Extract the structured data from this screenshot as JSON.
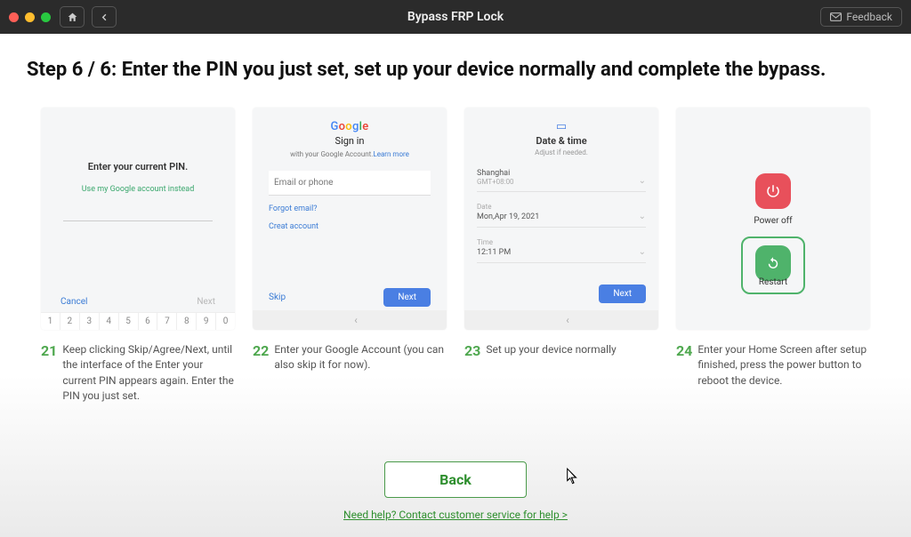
{
  "titlebar": {
    "title": "Bypass FRP Lock",
    "feedback": "Feedback"
  },
  "heading": "Step 6 / 6: Enter the PIN you just set, set up your device normally and complete the bypass.",
  "steps": [
    {
      "num": "21",
      "caption": "Keep clicking Skip/Agree/Next, until the interface of the Enter your current PIN appears again. Enter the PIN you just set."
    },
    {
      "num": "22",
      "caption": "Enter your Google Account (you can also skip it for now)."
    },
    {
      "num": "23",
      "caption": "Set up your device normally"
    },
    {
      "num": "24",
      "caption": "Enter your Home Screen after setup finished, press the power button to reboot the device."
    }
  ],
  "mock1": {
    "title": "Enter your current PIN.",
    "link": "Use my Google account instead",
    "cancel": "Cancel",
    "next": "Next",
    "keys": [
      "1",
      "2",
      "3",
      "4",
      "5",
      "6",
      "7",
      "8",
      "9",
      "0"
    ]
  },
  "mock2": {
    "signin": "Sign in",
    "sub_pre": "with your Google Account.",
    "sub_link": "Learn more",
    "placeholder": "Email or phone",
    "forgot": "Forgot email?",
    "create": "Creat account",
    "skip": "Skip",
    "next": "Next"
  },
  "mock3": {
    "title": "Date & time",
    "sub": "Adjust if needed.",
    "tz_label": "Shanghai",
    "tz_val": "GMT+08:00",
    "date_label": "Date",
    "date_val": "Mon,Apr 19, 2021",
    "time_label": "Time",
    "time_val": "12:11 PM",
    "next": "Next"
  },
  "mock4": {
    "poweroff": "Power off",
    "restart": "Restart"
  },
  "bottom": {
    "back": "Back",
    "help": "Need help? Contact customer service for help >"
  }
}
